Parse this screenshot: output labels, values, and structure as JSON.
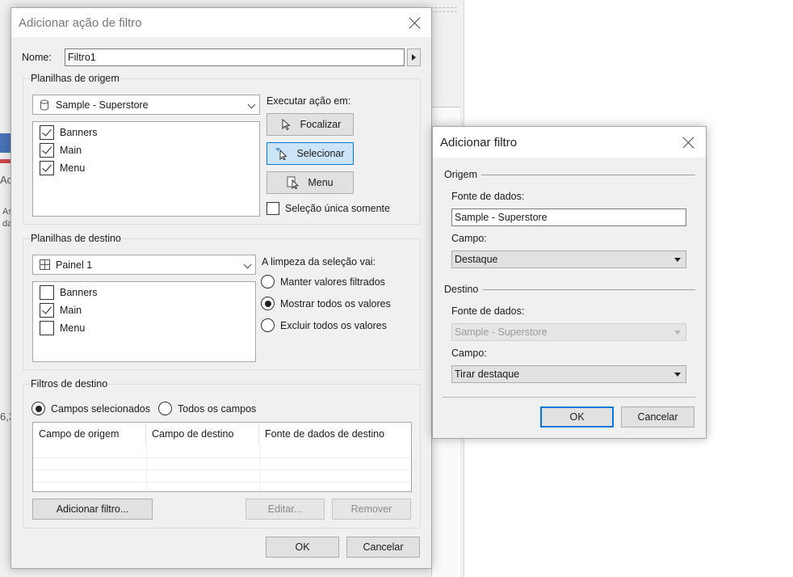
{
  "background": {
    "snippets": [
      "Ac",
      "As",
      "da",
      "6,3"
    ]
  },
  "filter_action_dialog": {
    "title": "Adicionar ação de filtro",
    "name_label": "Nome:",
    "name_value": "Filtro1",
    "source_group": {
      "label": "Planilhas de origem",
      "datasource": "Sample - Superstore",
      "sheets": [
        {
          "label": "Banners",
          "checked": true
        },
        {
          "label": "Main",
          "checked": true
        },
        {
          "label": "Menu",
          "checked": true
        }
      ],
      "run_action_label": "Executar ação em:",
      "actions": [
        {
          "label": "Focalizar",
          "icon": "pointer-icon",
          "selected": false
        },
        {
          "label": "Selecionar",
          "icon": "select-pointer-icon",
          "selected": true
        },
        {
          "label": "Menu",
          "icon": "menu-pointer-icon",
          "selected": false
        }
      ],
      "single_select_label": "Seleção única somente",
      "single_select_checked": false
    },
    "target_group": {
      "label": "Planilhas de destino",
      "dashboard": "Painel 1",
      "sheets": [
        {
          "label": "Banners",
          "checked": false
        },
        {
          "label": "Main",
          "checked": true
        },
        {
          "label": "Menu",
          "checked": false
        }
      ],
      "clear_label": "A limpeza da seleção vai:",
      "clear_options": [
        {
          "label": "Manter valores filtrados",
          "selected": false
        },
        {
          "label": "Mostrar todos os valores",
          "selected": true
        },
        {
          "label": "Excluir todos os valores",
          "selected": false
        }
      ]
    },
    "target_filters": {
      "label": "Filtros de destino",
      "options": [
        {
          "label": "Campos selecionados",
          "selected": true
        },
        {
          "label": "Todos os campos",
          "selected": false
        }
      ],
      "columns": [
        "Campo de origem",
        "Campo de destino",
        "Fonte de dados de destino"
      ],
      "add_button": "Adicionar filtro...",
      "edit_button": "Editar...",
      "remove_button": "Remover"
    },
    "ok": "OK",
    "cancel": "Cancelar"
  },
  "add_filter_dialog": {
    "title": "Adicionar filtro",
    "origin_section": "Origem",
    "origin_datasource_label": "Fonte de dados:",
    "origin_datasource_value": "Sample - Superstore",
    "origin_field_label": "Campo:",
    "origin_field_value": "Destaque",
    "dest_section": "Destino",
    "dest_datasource_label": "Fonte de dados:",
    "dest_datasource_value": "Sample - Superstore",
    "dest_field_label": "Campo:",
    "dest_field_value": "Tirar destaque",
    "ok": "OK",
    "cancel": "Cancelar"
  }
}
